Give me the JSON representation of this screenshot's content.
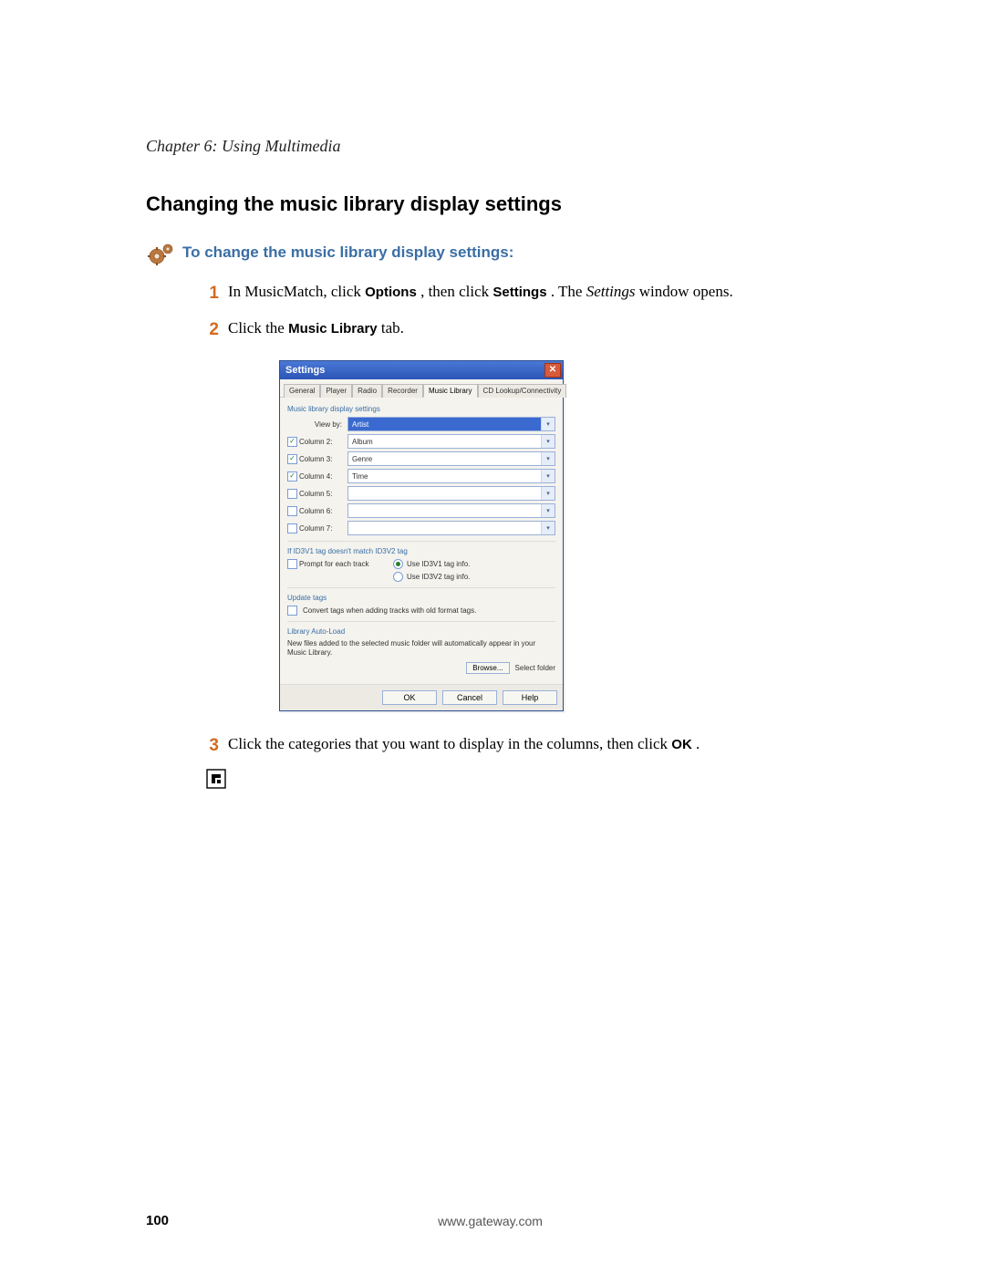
{
  "chapter": "Chapter 6: Using Multimedia",
  "heading": "Changing the music library display settings",
  "instruction_heading": "To change the music library display settings:",
  "steps": {
    "s1": {
      "num": "1",
      "pre": "In MusicMatch, click ",
      "b1": "Options",
      "mid1": ", then click ",
      "b2": "Settings",
      "mid2": ". The ",
      "it": "Settings",
      "post": " window opens."
    },
    "s2": {
      "num": "2",
      "pre": "Click the ",
      "b1": "Music Library",
      "post": " tab."
    },
    "s3": {
      "num": "3",
      "pre": "Click the categories that you want to display in the columns, then click ",
      "b1": "OK",
      "post": "."
    }
  },
  "dialog": {
    "title": "Settings",
    "tabs": [
      "General",
      "Player",
      "Radio",
      "Recorder",
      "Music Library",
      "CD Lookup/Connectivity"
    ],
    "section_display": "Music library display settings",
    "rows": [
      {
        "label": "View by:",
        "value": "Artist",
        "checked": null,
        "highlight": true
      },
      {
        "label": "Column 2:",
        "value": "Album",
        "checked": true
      },
      {
        "label": "Column 3:",
        "value": "Genre",
        "checked": true
      },
      {
        "label": "Column 4:",
        "value": "Time",
        "checked": true
      },
      {
        "label": "Column 5:",
        "value": "",
        "checked": false
      },
      {
        "label": "Column 6:",
        "value": "",
        "checked": false
      },
      {
        "label": "Column 7:",
        "value": "",
        "checked": false
      }
    ],
    "section_id3": "If ID3V1 tag doesn't match ID3V2 tag",
    "prompt_label": "Prompt for each track",
    "radio1": "Use ID3V1 tag info.",
    "radio2": "Use ID3V2 tag info.",
    "section_update": "Update tags",
    "convert_label": "Convert tags when adding tracks with old format tags.",
    "section_autoload": "Library Auto-Load",
    "autoload_text": "New files added to the selected music folder will automatically appear in your Music Library.",
    "browse_btn": "Browse...",
    "select_btn": "Select folder",
    "ok": "OK",
    "cancel": "Cancel",
    "help": "Help"
  },
  "footer": {
    "page": "100",
    "url": "www.gateway.com"
  }
}
